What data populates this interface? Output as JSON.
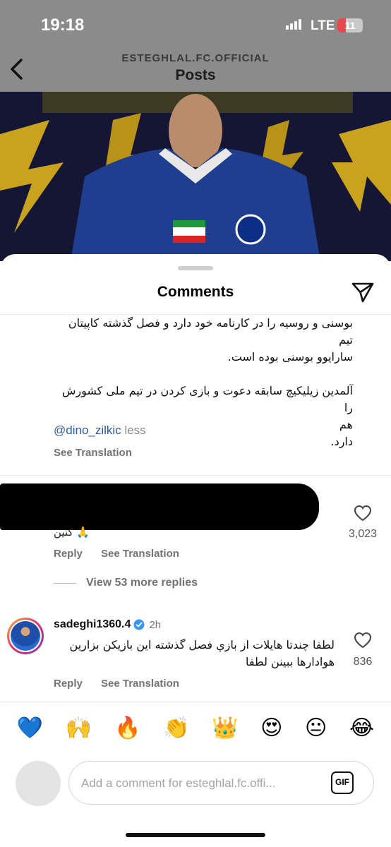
{
  "status": {
    "time": "19:18",
    "network": "LTE",
    "battery": "11",
    "battery_level": 0.11
  },
  "header": {
    "account": "ESTEGHLAL.FC.OFFICIAL",
    "title": "Posts"
  },
  "sheet": {
    "title": "Comments"
  },
  "caption": {
    "lines": [
      "بوسنی و روسیه را در کارنامه خود دارد و فصل گذشته کاپیتان تیم",
      "سارایوو بوسنی بوده است.",
      "",
      "آلمدین زیلیکیچ سابقه دعوت و بازی کردن در تیم ملی کشورش را",
      "هم",
      "دارد."
    ],
    "mention": "@dino_zilkic",
    "less": "less",
    "see_translation": "See Translation"
  },
  "comment1": {
    "text": "کنین 🙏",
    "likes": "3,023",
    "reply": "Reply",
    "see_translation": "See Translation",
    "view_replies": "View 53 more replies"
  },
  "comment2": {
    "username": "sadeghi1360.4",
    "time": "2h",
    "text": "لطفا چندتا هایلات از بازي فصل گذشته این بازیکن بزارین هوادارها ببینن لطفا",
    "likes": "836",
    "reply": "Reply",
    "see_translation": "See Translation"
  },
  "emoji_reactions": [
    "💙",
    "🙌",
    "🔥",
    "👏",
    "👑",
    "😍",
    "😐",
    "😂"
  ],
  "input": {
    "placeholder": "Add a comment for esteghlal.fc.offi...",
    "gif": "GIF"
  },
  "colors": {
    "mention": "#2f5a9b",
    "secondary_text": "#737373",
    "verified": "#3897f0",
    "battery": "#e5484d"
  }
}
